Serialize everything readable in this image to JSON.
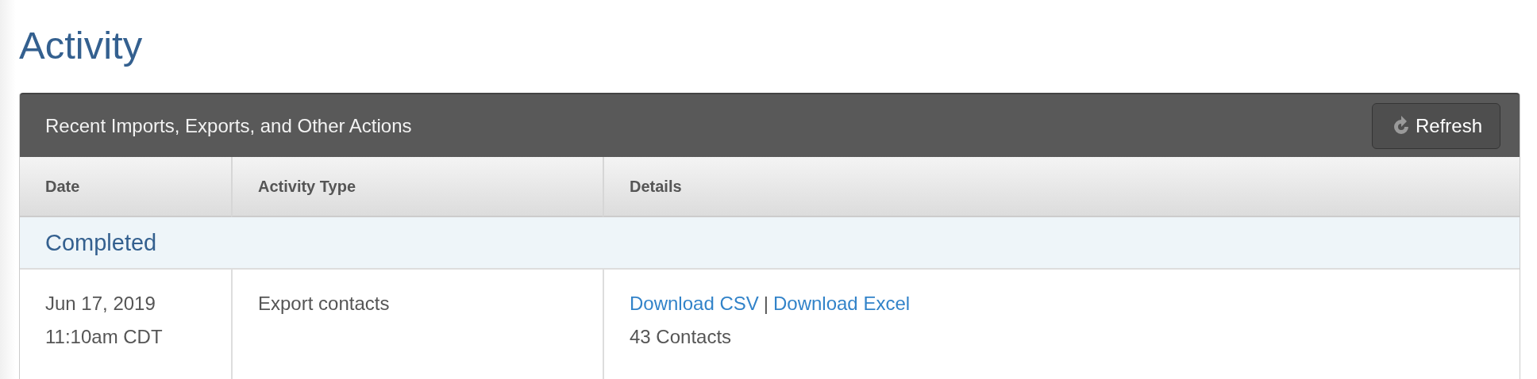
{
  "page": {
    "title": "Activity"
  },
  "panel": {
    "title": "Recent Imports, Exports, and Other Actions",
    "refresh_button": {
      "label": "Refresh"
    }
  },
  "table": {
    "columns": [
      "Date",
      "Activity Type",
      "Details"
    ],
    "groups": [
      {
        "label": "Completed",
        "rows": [
          {
            "date": "Jun 17, 2019",
            "time": "11:10am CDT",
            "activity_type": "Export contacts",
            "links": [
              "Download CSV",
              "Download Excel"
            ],
            "separator": "|",
            "summary": "43 Contacts"
          }
        ]
      }
    ]
  }
}
